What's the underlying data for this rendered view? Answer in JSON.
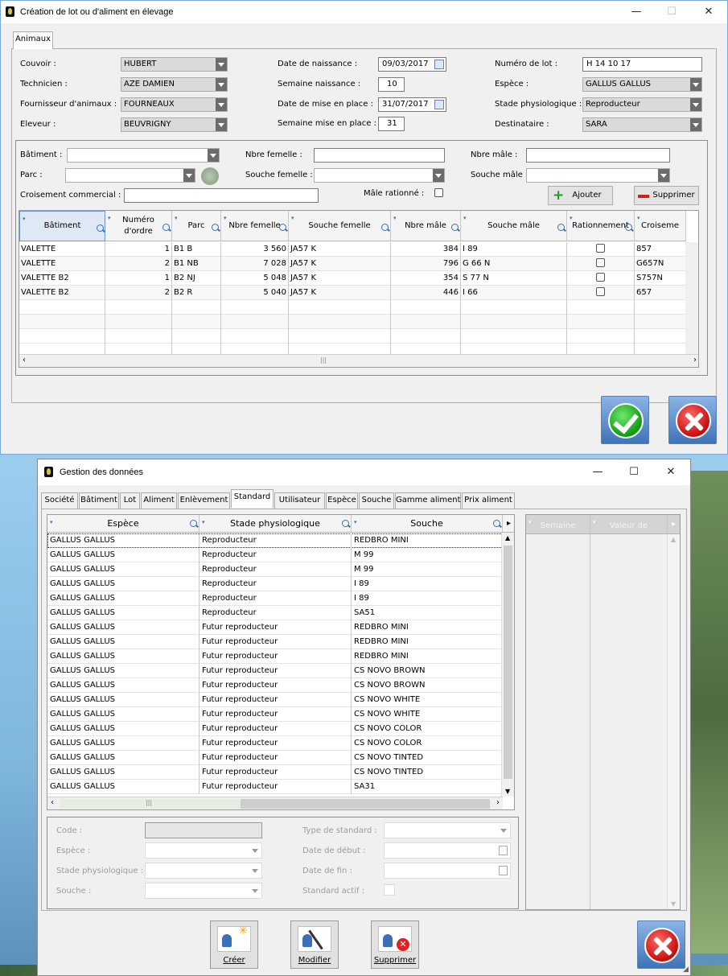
{
  "win1": {
    "title": "Création de lot ou d'aliment en élevage",
    "tab": "Animaux",
    "fields": {
      "couvoir_label": "Couvoir :",
      "couvoir": "HUBERT",
      "technicien_label": "Technicien :",
      "technicien": "AZE DAMIEN",
      "fournisseur_label": "Fournisseur d'animaux :",
      "fournisseur": "FOURNEAUX",
      "eleveur_label": "Eleveur :",
      "eleveur": "BEUVRIGNY",
      "date_naissance_label": "Date de naissance :",
      "date_naissance": "09/03/2017",
      "semaine_naissance_label": "Semaine naissance :",
      "semaine_naissance": "10",
      "date_mise_label": "Date de mise en place :",
      "date_mise": "31/07/2017",
      "semaine_mise_label": "Semaine mise en place :",
      "semaine_mise": "31",
      "numero_lot_label": "Numéro de lot :",
      "numero_lot": "H 14 10 17",
      "espece_label": "Espèce :",
      "espece": "GALLUS GALLUS",
      "stade_label": "Stade physiologique :",
      "stade": "Reproducteur",
      "destinataire_label": "Destinataire :",
      "destinataire": "SARA"
    },
    "sub": {
      "batiment_label": "Bâtiment :",
      "parc_label": "Parc :",
      "croisement_label": "Croisement commercial :",
      "nbre_femelle_label": "Nbre femelle :",
      "souche_femelle_label": "Souche femelle :",
      "male_rationne_label": "Mâle rationné :",
      "nbre_male_label": "Nbre mâle :",
      "souche_male_label": "Souche mâle :",
      "ajouter": "Ajouter",
      "supprimer": "Supprimer"
    },
    "grid": {
      "headers": [
        "Bâtiment",
        "Numéro d'ordre",
        "Parc",
        "Nbre femelle",
        "Souche femelle",
        "Nbre mâle",
        "Souche mâle",
        "Rationnement",
        "Croiseme"
      ],
      "rows": [
        [
          "VALETTE",
          "1",
          "B1 B",
          "3 560",
          "JA57 K",
          "384",
          "I 89",
          "",
          "857"
        ],
        [
          "VALETTE",
          "2",
          "B1 NB",
          "7 028",
          "JA57 K",
          "796",
          "G 66 N",
          "",
          "G657N"
        ],
        [
          "VALETTE  B2",
          "1",
          "B2 NJ",
          "5 048",
          "JA57 K",
          "354",
          "S 77 N",
          "",
          "S757N"
        ],
        [
          "VALETTE  B2",
          "2",
          "B2 R",
          "5 040",
          "JA57 K",
          "446",
          "I 66",
          "",
          "657"
        ]
      ]
    }
  },
  "win2": {
    "title": "Gestion des données",
    "tabs": [
      "Société",
      "Bâtiment",
      "Lot",
      "Aliment",
      "Enlèvement",
      "Standard",
      "Utilisateur",
      "Espèce",
      "Souche",
      "Gamme aliment",
      "Prix aliment"
    ],
    "active_tab": "Standard",
    "grid_headers": [
      "Espèce",
      "Stade physiologique",
      "Souche"
    ],
    "side_headers": [
      "Semaine",
      "Valeur de"
    ],
    "rows": [
      [
        "GALLUS GALLUS",
        "Reproducteur",
        "REDBRO MINI"
      ],
      [
        "GALLUS GALLUS",
        "Reproducteur",
        "M 99"
      ],
      [
        "GALLUS GALLUS",
        "Reproducteur",
        "M 99"
      ],
      [
        "GALLUS GALLUS",
        "Reproducteur",
        "I 89"
      ],
      [
        "GALLUS GALLUS",
        "Reproducteur",
        "I 89"
      ],
      [
        "GALLUS GALLUS",
        "Reproducteur",
        "SA51"
      ],
      [
        "GALLUS GALLUS",
        "Futur reproducteur",
        "REDBRO MINI"
      ],
      [
        "GALLUS GALLUS",
        "Futur reproducteur",
        "REDBRO MINI"
      ],
      [
        "GALLUS GALLUS",
        "Futur reproducteur",
        "REDBRO MINI"
      ],
      [
        "GALLUS GALLUS",
        "Futur reproducteur",
        "CS NOVO BROWN"
      ],
      [
        "GALLUS GALLUS",
        "Futur reproducteur",
        "CS NOVO BROWN"
      ],
      [
        "GALLUS GALLUS",
        "Futur reproducteur",
        "CS NOVO WHITE"
      ],
      [
        "GALLUS GALLUS",
        "Futur reproducteur",
        "CS NOVO WHITE"
      ],
      [
        "GALLUS GALLUS",
        "Futur reproducteur",
        "CS NOVO COLOR"
      ],
      [
        "GALLUS GALLUS",
        "Futur reproducteur",
        "CS NOVO COLOR"
      ],
      [
        "GALLUS GALLUS",
        "Futur reproducteur",
        "CS NOVO TINTED"
      ],
      [
        "GALLUS GALLUS",
        "Futur reproducteur",
        "CS NOVO TINTED"
      ],
      [
        "GALLUS GALLUS",
        "Futur reproducteur",
        "SA31"
      ]
    ],
    "form": {
      "code_label": "Code :",
      "espece_label": "Espèce :",
      "stade_label": "Stade physiologique :",
      "souche_label": "Souche :",
      "type_label": "Type de standard :",
      "debut_label": "Date de début :",
      "fin_label": "Date de fin :",
      "actif_label": "Standard actif :"
    },
    "buttons": {
      "creer": "Créer",
      "modifier": "Modifier",
      "supprimer": "Supprimer"
    }
  }
}
